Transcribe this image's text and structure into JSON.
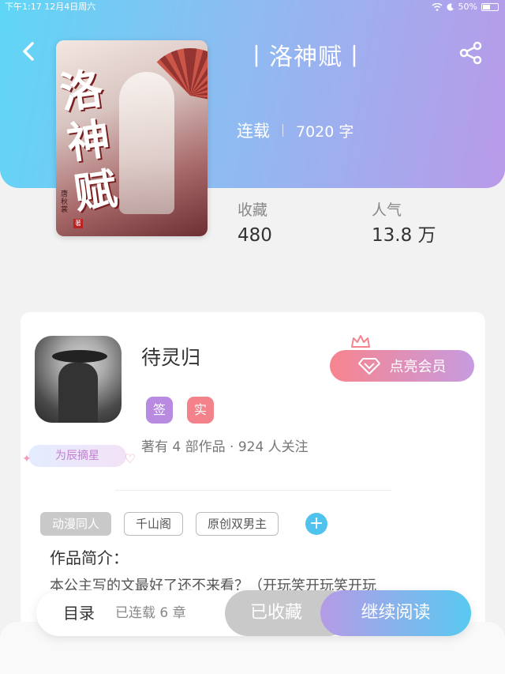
{
  "status_bar": {
    "time_date": "下午1:17  12月4日周六",
    "battery": "50%"
  },
  "book": {
    "title": "丨洛神赋丨",
    "cover_title": "洛神赋",
    "cover_author": "唐秋裳",
    "cover_seal": "著",
    "status": "连载",
    "word_count": "7020 字"
  },
  "stats": {
    "favorites_label": "收藏",
    "favorites_value": "480",
    "popularity_label": "人气",
    "popularity_value": "13.8 万"
  },
  "author": {
    "name": "待灵归",
    "star_badge": "为辰摘星",
    "vip_label": "点亮会员",
    "badges": [
      {
        "label": "签",
        "color": "#b98be0"
      },
      {
        "label": "实",
        "color": "#f3828b"
      }
    ],
    "stats_text": "著有 4 部作品 · 924 人关注"
  },
  "tags": [
    {
      "label": "动漫同人",
      "filled": true
    },
    {
      "label": "千山阁",
      "filled": false
    },
    {
      "label": "原创双男主",
      "filled": false
    }
  ],
  "intro": {
    "title": "作品简介：",
    "text": "本公主写的文最好了还不来看？（开玩笑开玩笑开玩"
  },
  "action_bar": {
    "toc_label": "目录",
    "toc_count": "已连载 6 章",
    "collected_label": "已收藏",
    "read_label": "继续阅读"
  },
  "colors": {
    "header_gradient_start": "#5fd6f6",
    "header_gradient_end": "#b99ae9",
    "accent_blue": "#4fc3ee",
    "vip_pink": "#f7848e"
  }
}
